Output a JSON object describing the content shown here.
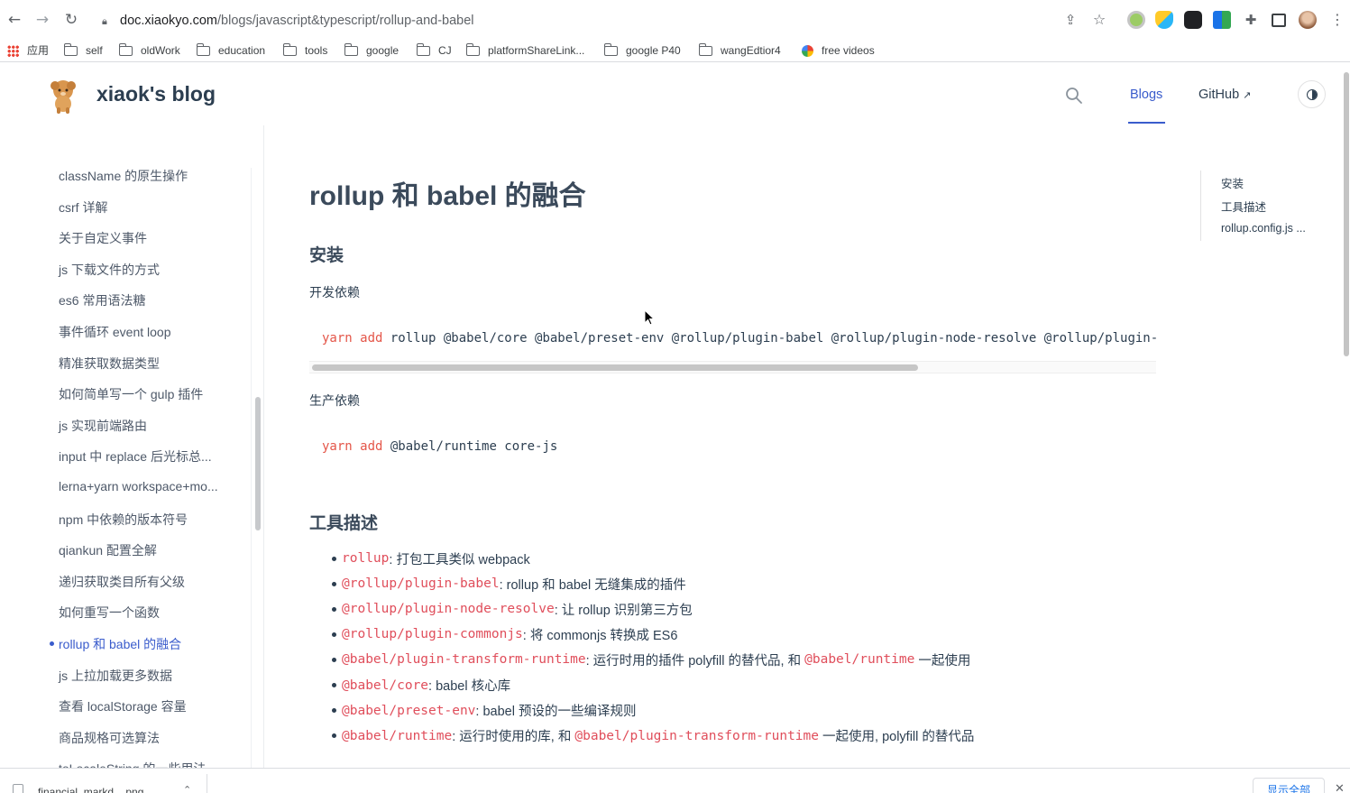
{
  "browser": {
    "url_host": "doc.xiaokyo.com",
    "url_path": "/blogs/javascript&typescript/rollup-and-babel",
    "bookmarks": {
      "apps": "应用",
      "items": [
        "self",
        "oldWork",
        "education",
        "tools",
        "google",
        "CJ",
        "platformShareLink...",
        "google P40",
        "wangEdtior4",
        "free videos"
      ]
    }
  },
  "site": {
    "title": "xiaok's blog",
    "nav": {
      "blogs": "Blogs",
      "github": "GitHub"
    }
  },
  "sidebar": {
    "items": [
      "className 的原生操作",
      "csrf 详解",
      "关于自定义事件",
      "js 下载文件的方式",
      "es6 常用语法糖",
      "事件循环 event loop",
      "精准获取数据类型",
      "如何简单写一个 gulp 插件",
      "js 实现前端路由",
      "input 中 replace 后光标总...",
      "lerna+yarn workspace+mo...",
      "npm 中依赖的版本符号",
      "qiankun 配置全解",
      "递归获取类目所有父级",
      "如何重写一个函数",
      "rollup 和 babel 的融合",
      "js 上拉加载更多数据",
      "查看 localStorage 容量",
      "商品规格可选算法",
      "toLocaleString 的一些用法"
    ],
    "active_index": 15
  },
  "article": {
    "title": "rollup 和 babel 的融合",
    "install_heading": "安装",
    "dev_label": "开发依赖",
    "dev_cmd": {
      "kw": "yarn add",
      "rest": " rollup @babel/core @babel/preset-env @rollup/plugin-babel @rollup/plugin-node-resolve @rollup/plugin-commonjs @babel/plugin-transform-runtime"
    },
    "prod_label": "生产依赖",
    "prod_cmd": {
      "kw": "yarn add",
      "rest": " @babel/runtime core-js"
    },
    "tools_heading": "工具描述",
    "tools": [
      {
        "code": "rollup",
        "text": ": 打包工具类似 webpack"
      },
      {
        "code": "@rollup/plugin-babel",
        "text": ": rollup 和 babel 无缝集成的插件"
      },
      {
        "code": "@rollup/plugin-node-resolve",
        "text": ": 让 rollup 识别第三方包"
      },
      {
        "code": "@rollup/plugin-commonjs",
        "text": ": 将 commonjs 转换成 ES6"
      },
      {
        "code": "@babel/plugin-transform-runtime",
        "text": ": 运行时用的插件 polyfill 的替代品, 和 ",
        "code2": "@babel/runtime",
        "text2": " 一起使用"
      },
      {
        "code": "@babel/core",
        "text": ": babel 核心库"
      },
      {
        "code": "@babel/preset-env",
        "text": ": babel 预设的一些编译规则"
      },
      {
        "code": "@babel/runtime",
        "text": ": 运行时使用的库, 和 ",
        "code2": "@babel/plugin-transform-runtime",
        "text2": " 一起使用, polyfill 的替代品"
      }
    ]
  },
  "toc": [
    "安装",
    "工具描述",
    "rollup.config.js ..."
  ],
  "downloads": {
    "file": "financial_markd....png",
    "show_all": "显示全部"
  },
  "colors": {
    "accent": "#3a5ccc",
    "code": "#e04e5b",
    "text": "#2c3e50"
  }
}
